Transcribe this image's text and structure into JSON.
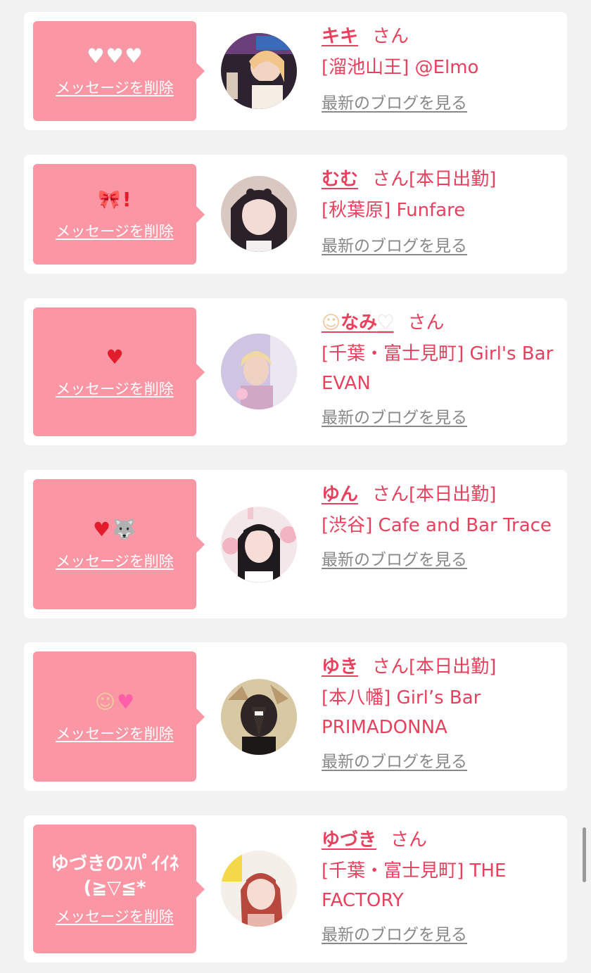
{
  "delete_label": "メッセージを削除",
  "blog_label": "最新のブログを見る",
  "san_label": "さん",
  "cards": [
    {
      "emoji_names": [
        "white-heart-icon",
        "white-heart-icon",
        "white-heart-icon"
      ],
      "name": "キキ",
      "suffix": "さん",
      "shop": "[溜池山王] @Elmo"
    },
    {
      "emoji_names": [
        "ribbon-bow-icon",
        "exclamation-icon"
      ],
      "name": "むむ",
      "suffix": "さん[本日出勤]",
      "shop": "[秋葉原] Funfare"
    },
    {
      "emoji_names": [
        "red-heart-icon"
      ],
      "name_prefix_emoji": "blonde-person-icon",
      "name": "なみ",
      "name_suffix_emoji": "white-heart-icon",
      "suffix": "さん",
      "shop": "[千葉・富士見町] Girl's Bar EVAN"
    },
    {
      "emoji_names": [
        "red-heart-icon",
        "wolf-icon"
      ],
      "name": "ゆん",
      "suffix": "さん[本日出勤]",
      "shop": "[渋谷] Cafe and Bar Trace"
    },
    {
      "emoji_names": [
        "baby-icon",
        "two-hearts-icon"
      ],
      "name": "ゆき",
      "suffix": "さん[本日出勤]",
      "shop": "[本八幡] Girl’s Bar PRIMADONNA"
    },
    {
      "message": "ゆづきのｽﾊﾟｲｲﾈ\n(≧▽≦*",
      "name": "ゆづき",
      "suffix": "さん",
      "shop": "[千葉・富士見町] THE FACTORY"
    }
  ]
}
